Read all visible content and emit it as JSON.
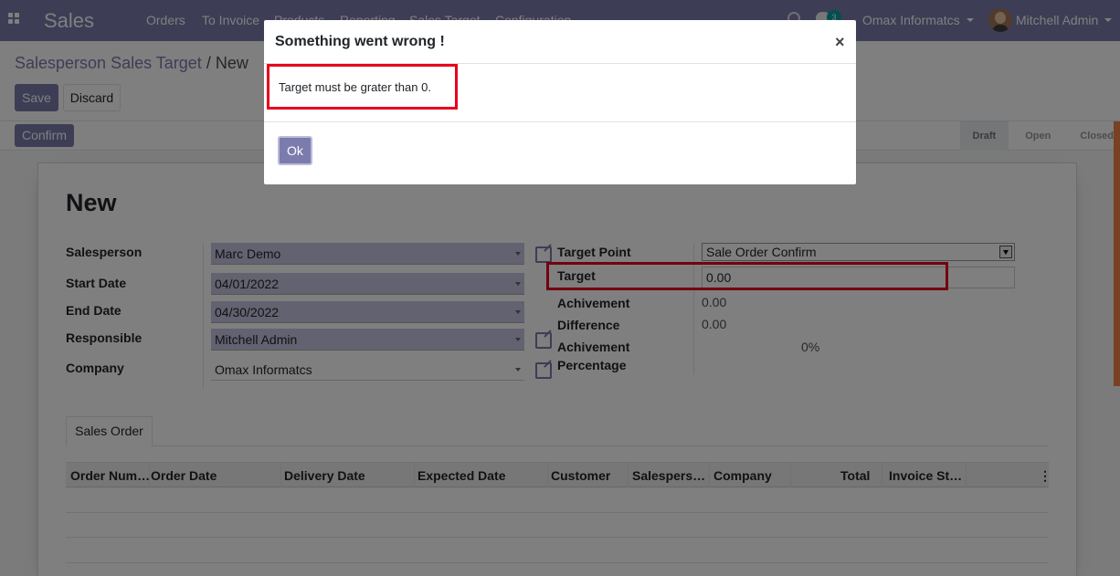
{
  "navbar": {
    "app_name": "Sales",
    "menu": [
      "Orders",
      "To Invoice",
      "Products",
      "Reporting",
      "Sales Target",
      "Configuration"
    ],
    "chat_count": "3",
    "company": "Omax Informatcs",
    "user": "Mitchell Admin"
  },
  "breadcrumb": {
    "parent": "Salesperson Sales Target",
    "separator": "/",
    "current": "New"
  },
  "buttons": {
    "save": "Save",
    "discard": "Discard",
    "confirm": "Confirm"
  },
  "status": [
    "Draft",
    "Open",
    "Closed"
  ],
  "form": {
    "title": "New",
    "salesperson_label": "Salesperson",
    "salesperson": "Marc Demo",
    "start_date_label": "Start Date",
    "start_date": "04/01/2022",
    "end_date_label": "End Date",
    "end_date": "04/30/2022",
    "responsible_label": "Responsible",
    "responsible": "Mitchell Admin",
    "company_label": "Company",
    "company": "Omax Informatcs",
    "target_point_label": "Target Point",
    "target_point": "Sale Order Confirm",
    "target_label": "Target",
    "target": "0.00",
    "achivement_label": "Achivement",
    "achivement": "0.00",
    "difference_label": "Difference",
    "difference": "0.00",
    "achivement_pct_label_1": "Achivement",
    "achivement_pct_label_2": "Percentage",
    "achivement_pct": "0%"
  },
  "tab": "Sales Order",
  "table": {
    "columns": [
      "Order Num…",
      "Order Date",
      "Delivery Date",
      "Expected Date",
      "Customer",
      "Salespers…",
      "Company",
      "Total",
      "Invoice St…"
    ]
  },
  "dialog": {
    "title": "Something went wrong !",
    "close": "×",
    "message": "Target must be grater than 0.",
    "ok": "Ok"
  },
  "colors": {
    "brand": "#7c7bad",
    "highlight": "#e8001c"
  }
}
